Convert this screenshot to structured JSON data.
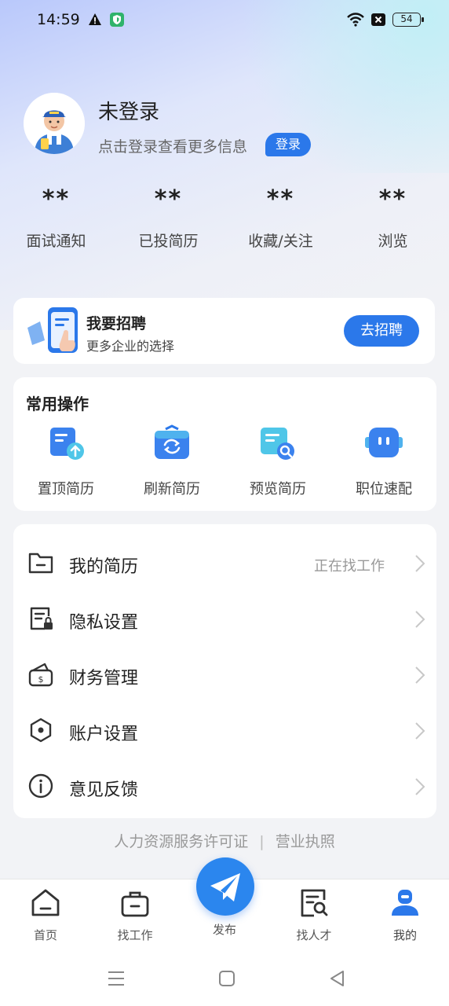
{
  "status_bar": {
    "time": "14:59",
    "battery": "54"
  },
  "profile": {
    "name": "未登录",
    "hint": "点击登录查看更多信息",
    "login_label": "登录"
  },
  "stats": [
    {
      "value": "**",
      "label": "面试通知"
    },
    {
      "value": "**",
      "label": "已投简历"
    },
    {
      "value": "**",
      "label": "收藏/关注"
    },
    {
      "value": "**",
      "label": "浏览"
    }
  ],
  "recruit": {
    "title": "我要招聘",
    "subtitle": "更多企业的选择",
    "button": "去招聘"
  },
  "common_ops": {
    "title": "常用操作",
    "items": [
      {
        "label": "置顶简历",
        "icon": "resume-top-icon"
      },
      {
        "label": "刷新简历",
        "icon": "refresh-resume-icon"
      },
      {
        "label": "预览简历",
        "icon": "preview-resume-icon"
      },
      {
        "label": "职位速配",
        "icon": "job-match-icon"
      }
    ]
  },
  "menu": [
    {
      "label": "我的简历",
      "right": "正在找工作",
      "icon": "folder-icon"
    },
    {
      "label": "隐私设置",
      "right": "",
      "icon": "privacy-lock-icon"
    },
    {
      "label": "财务管理",
      "right": "",
      "icon": "wallet-icon"
    },
    {
      "label": "账户设置",
      "right": "",
      "icon": "settings-hex-icon"
    },
    {
      "label": "意见反馈",
      "right": "",
      "icon": "info-icon"
    }
  ],
  "footer": {
    "license": "人力资源服务许可证",
    "separator": "|",
    "business": "营业执照"
  },
  "tabbar": {
    "home": "首页",
    "find_job": "找工作",
    "publish": "发布",
    "find_talent": "找人才",
    "mine": "我的"
  },
  "colors": {
    "accent": "#2b78ea",
    "background": "#f2f3f6"
  }
}
